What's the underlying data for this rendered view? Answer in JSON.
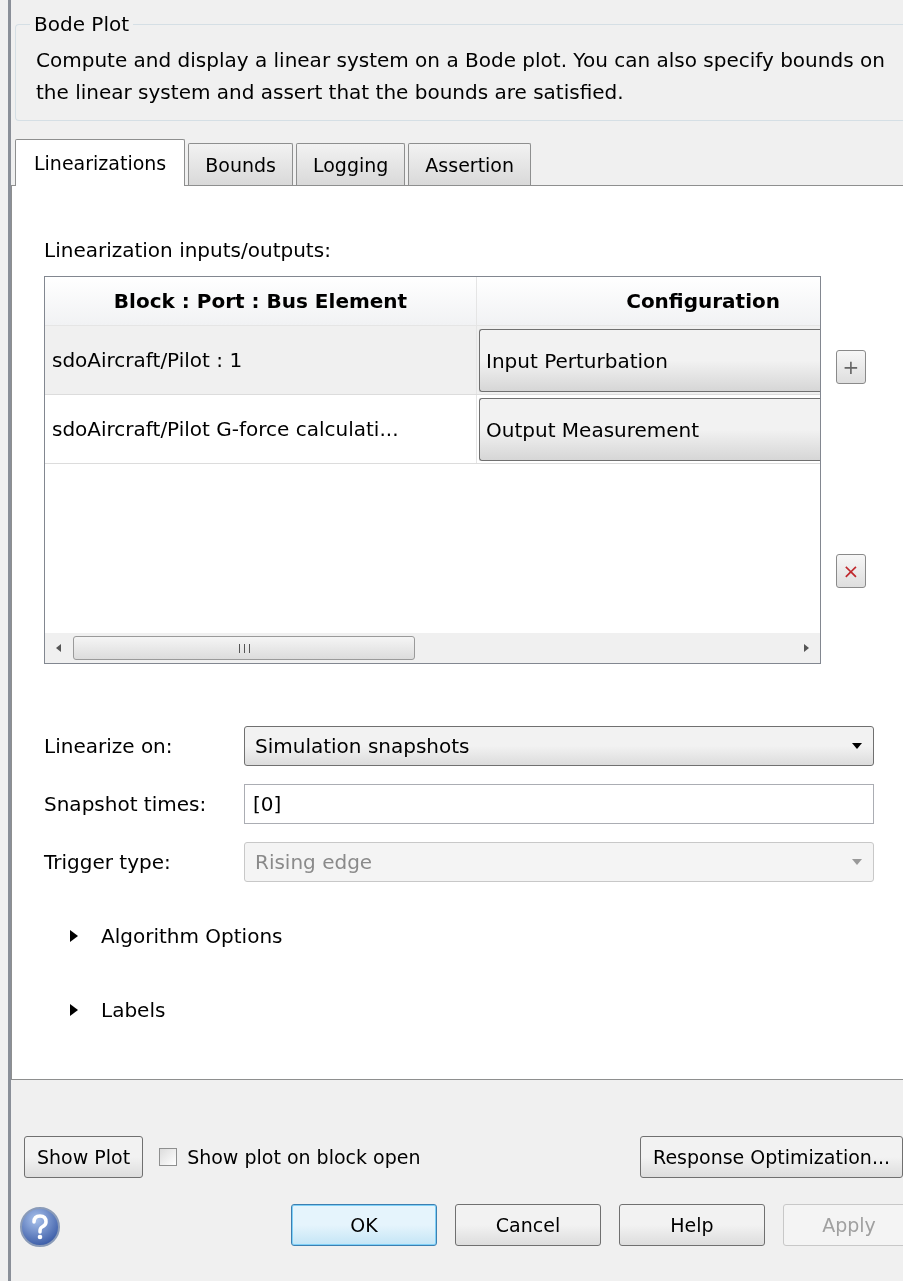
{
  "group": {
    "title": "Bode Plot",
    "description": "Compute and display a linear system on a Bode plot. You can also specify bounds on the linear system and assert that the bounds are satisfied."
  },
  "tabs": [
    {
      "label": "Linearizations",
      "selected": true
    },
    {
      "label": "Bounds",
      "selected": false
    },
    {
      "label": "Logging",
      "selected": false
    },
    {
      "label": "Assertion",
      "selected": false
    }
  ],
  "io_table": {
    "label": "Linearization inputs/outputs:",
    "columns": [
      "Block : Port : Bus Element",
      "Configuration"
    ],
    "rows": [
      {
        "block": "sdoAircraft/Pilot : 1",
        "configuration": "Input Perturbation",
        "selected": true
      },
      {
        "block": "sdoAircraft/Pilot G-force calculati...",
        "configuration": "Output Measurement",
        "selected": false
      }
    ],
    "add_button": "+",
    "delete_button": "×"
  },
  "fields": [
    {
      "kind": "dropdown",
      "label": "Linearize on:",
      "value": "Simulation snapshots",
      "disabled": false
    },
    {
      "kind": "text",
      "label": "Snapshot times:",
      "value": "[0]",
      "disabled": false
    },
    {
      "kind": "dropdown",
      "label": "Trigger type:",
      "value": "Rising edge",
      "disabled": true
    }
  ],
  "sections": [
    {
      "label": "Algorithm Options",
      "expanded": false
    },
    {
      "label": "Labels",
      "expanded": false
    }
  ],
  "show_plot_button": "Show Plot",
  "show_on_open": {
    "label": "Show plot on block open",
    "checked": false
  },
  "response_optimization_button": "Response Optimization...",
  "buttons": [
    {
      "label": "OK",
      "default": true,
      "disabled": false
    },
    {
      "label": "Cancel",
      "default": false,
      "disabled": false
    },
    {
      "label": "Help",
      "default": false,
      "disabled": false
    },
    {
      "label": "Apply",
      "default": false,
      "disabled": true
    }
  ]
}
